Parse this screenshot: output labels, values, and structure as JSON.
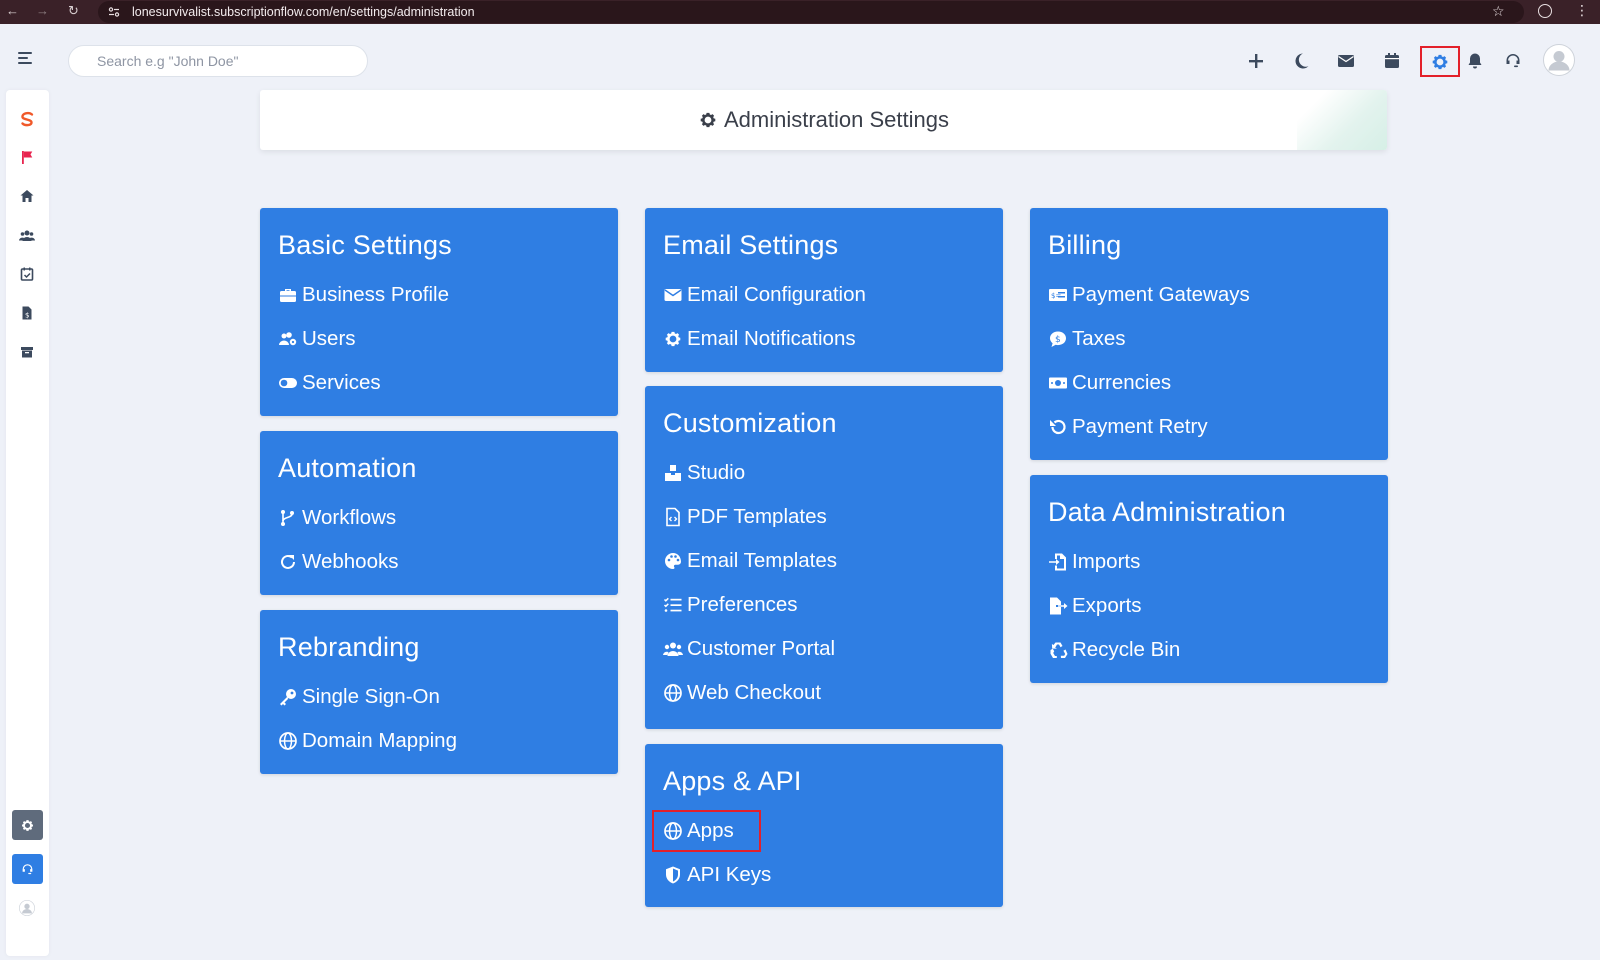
{
  "browser": {
    "url": "lonesurvivalist.subscriptionflow.com/en/settings/administration"
  },
  "topbar": {
    "search_placeholder": "Search e.g \"John Doe\"",
    "icons": [
      "plus-icon",
      "moon-icon",
      "mail-icon",
      "calendar-icon",
      "gear-icon",
      "bell-icon",
      "headset-icon",
      "avatar"
    ],
    "highlight_color": "#e3202a"
  },
  "header": {
    "title": "Administration Settings"
  },
  "cards": {
    "basic": {
      "title": "Basic Settings",
      "items": [
        "Business Profile",
        "Users",
        "Services"
      ]
    },
    "automation": {
      "title": "Automation",
      "items": [
        "Workflows",
        "Webhooks"
      ]
    },
    "rebranding": {
      "title": "Rebranding",
      "items": [
        "Single Sign-On",
        "Domain Mapping"
      ]
    },
    "email": {
      "title": "Email Settings",
      "items": [
        "Email Configuration",
        "Email Notifications"
      ]
    },
    "customization": {
      "title": "Customization",
      "items": [
        "Studio",
        "PDF Templates",
        "Email Templates",
        "Preferences",
        "Customer Portal",
        "Web Checkout"
      ]
    },
    "apps": {
      "title": "Apps & API",
      "items": [
        "Apps",
        "API Keys"
      ]
    },
    "billing": {
      "title": "Billing",
      "items": [
        "Payment Gateways",
        "Taxes",
        "Currencies",
        "Payment Retry"
      ]
    },
    "data": {
      "title": "Data Administration",
      "items": [
        "Imports",
        "Exports",
        "Recycle Bin"
      ]
    }
  },
  "colors": {
    "card_blue": "#2f7ee3",
    "page_bg": "#eef1f8",
    "brand_orange": "#f0592a",
    "flag_red": "#e8254f"
  }
}
